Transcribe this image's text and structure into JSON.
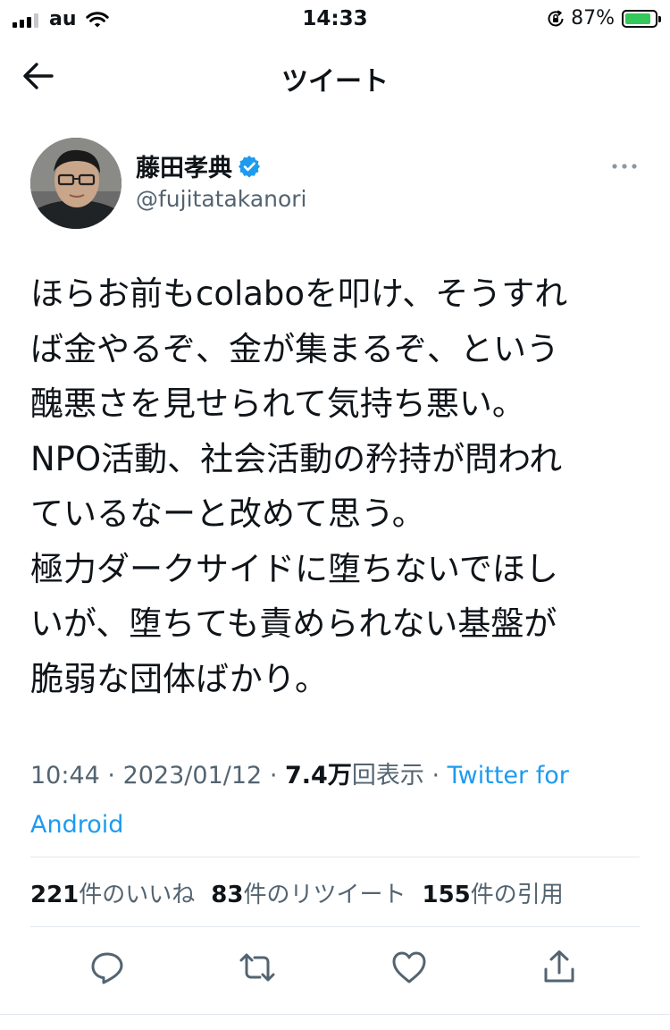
{
  "status_bar": {
    "carrier": "au",
    "time": "14:33",
    "battery_percent": "87%",
    "battery_level": 0.87,
    "battery_color": "#34c759"
  },
  "nav": {
    "title": "ツイート",
    "back_icon": "arrow-left-icon"
  },
  "author": {
    "name": "藤田孝典",
    "handle": "@fujitatakanori",
    "verified": true,
    "verified_color": "#1d9bf0"
  },
  "tweet": {
    "lines": [
      "ほらお前もcolaboを叩け、そうすれ",
      "ば金やるぞ、金が集まるぞ、という",
      "醜悪さを見せられて気持ち悪い。",
      "NPO活動、社会活動の矜持が問われ",
      "ているなーと改めて思う。",
      "極力ダークサイドに堕ちないでほし",
      "いが、堕ちても責められない基盤が",
      "脆弱な団体ばかり。"
    ]
  },
  "meta": {
    "time": "10:44",
    "separator": "·",
    "date": "2023/01/12",
    "views_count": "7.4万",
    "views_label": "回表示",
    "source": "Twitter for Android"
  },
  "stats": {
    "likes_count": "221",
    "likes_label": "件のいいね",
    "retweets_count": "83",
    "retweets_label": "件のリツイート",
    "quotes_count": "155",
    "quotes_label": "件の引用"
  },
  "actions": [
    "reply-icon",
    "retweet-icon",
    "like-icon",
    "share-icon"
  ],
  "colors": {
    "text": "#0f1419",
    "secondary": "#536471",
    "accent": "#1d9bf0",
    "divider": "#e1e8ed"
  }
}
